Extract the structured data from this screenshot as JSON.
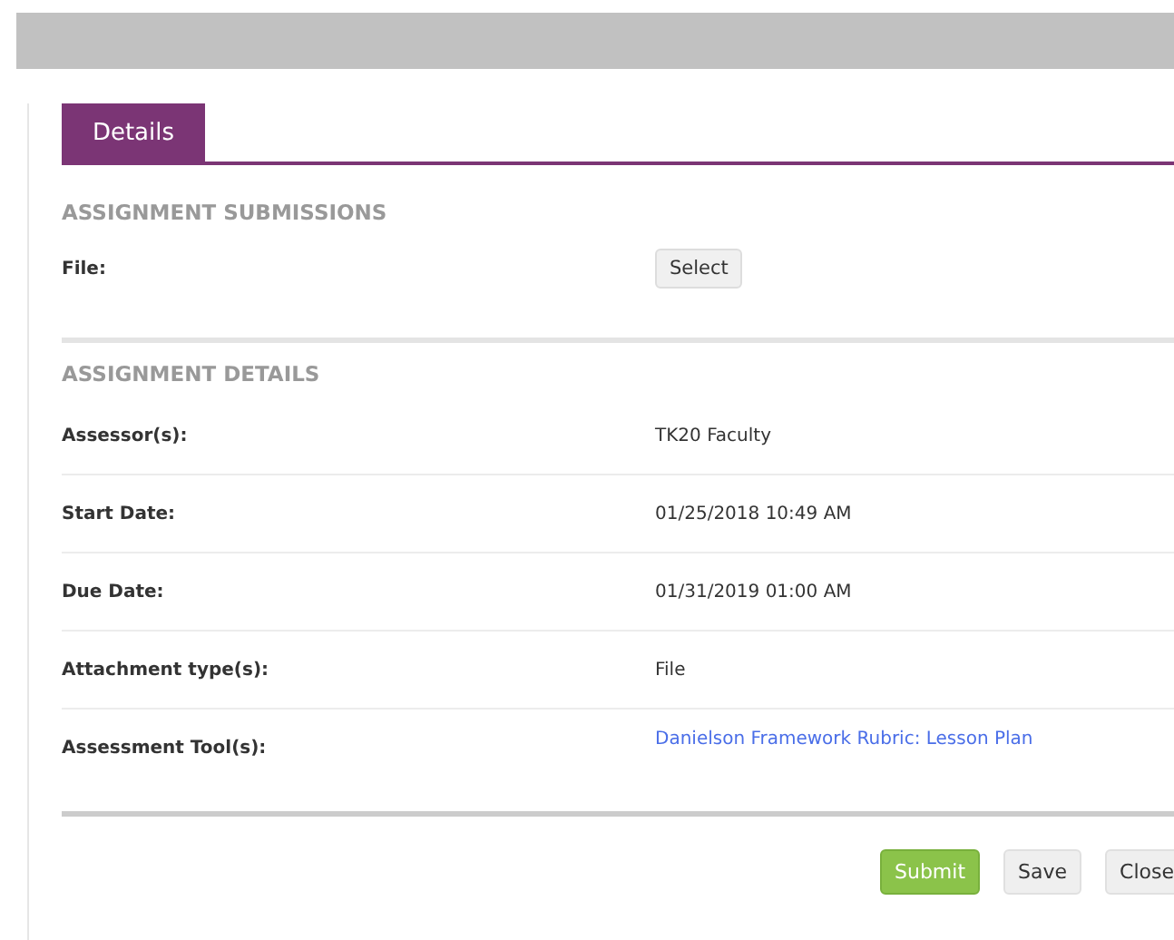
{
  "tabs": [
    {
      "label": "Details",
      "selected": true
    }
  ],
  "sections": [
    {
      "heading": "ASSIGNMENT SUBMISSIONS",
      "rows": [
        {
          "label": "File:",
          "kind": "button",
          "value": "Select"
        }
      ]
    },
    {
      "heading": "ASSIGNMENT DETAILS",
      "rows": [
        {
          "label": "Assessor(s):",
          "kind": "text",
          "value": "TK20 Faculty"
        },
        {
          "label": "Start Date:",
          "kind": "text",
          "value": "01/25/2018 10:49 AM"
        },
        {
          "label": "Due Date:",
          "kind": "text",
          "value": "01/31/2019 01:00 AM"
        },
        {
          "label": "Attachment type(s):",
          "kind": "text",
          "value": "File"
        },
        {
          "label": "Assessment Tool(s):",
          "kind": "link",
          "value": "Danielson Framework Rubric: Lesson Plan"
        }
      ]
    }
  ],
  "buttons": [
    {
      "label": "Submit",
      "kind": "primary"
    },
    {
      "label": "Save",
      "kind": "default"
    },
    {
      "label": "Close",
      "kind": "default"
    }
  ]
}
